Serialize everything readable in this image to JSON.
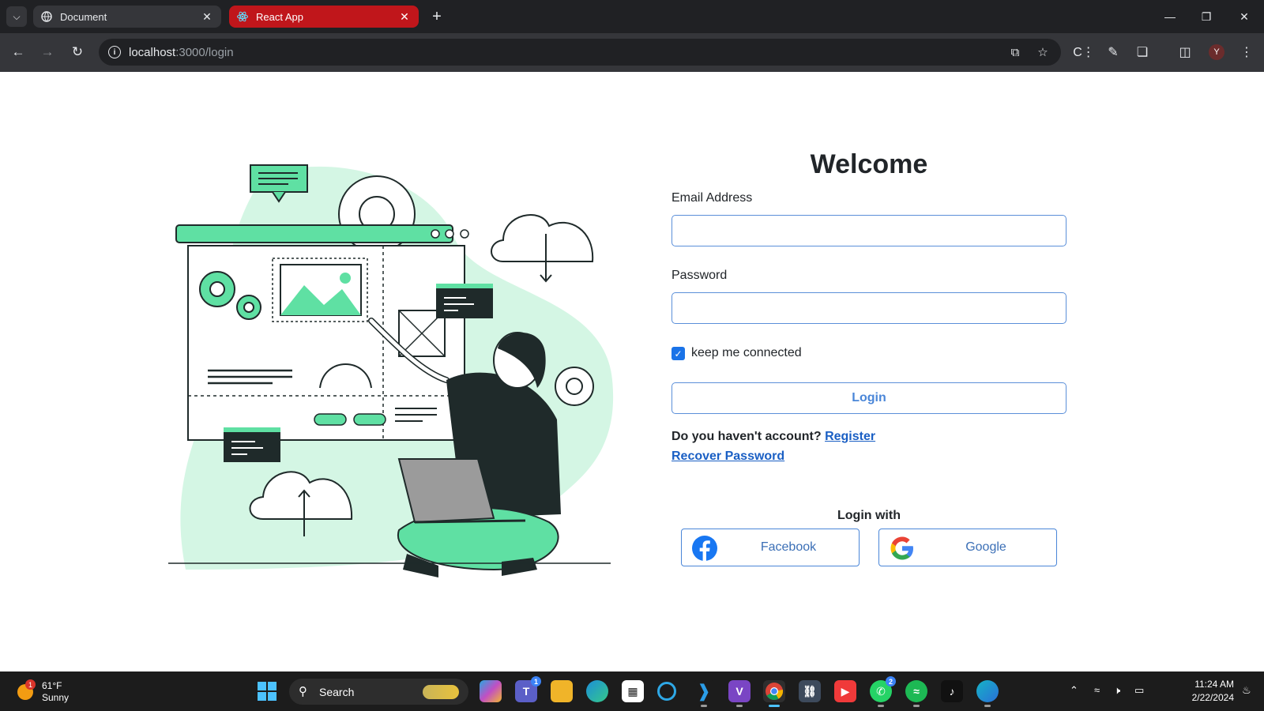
{
  "browser": {
    "tabs": [
      {
        "label": "Document",
        "icon": "globe-icon",
        "active": false
      },
      {
        "label": "React App",
        "icon": "react-icon",
        "active": true
      }
    ],
    "address": {
      "host": "localhost",
      "path": ":3000/login"
    },
    "accent_color": "#c0161b",
    "profile_initial": "Y"
  },
  "login": {
    "title": "Welcome",
    "email_label": "Email Address",
    "email_value": "",
    "password_label": "Password",
    "password_value": "",
    "remember_label": "keep me connected",
    "remember_checked": true,
    "login_button": "Login",
    "no_account_text": "Do you haven't account?",
    "register_link": "Register",
    "recover_link": "Recover Password",
    "login_with": "Login with",
    "facebook_label": "Facebook",
    "google_label": "Google",
    "primary_color": "#1a73e8",
    "illustration_color": "#5fe0a3"
  },
  "taskbar": {
    "weather": {
      "temp": "61°F",
      "condition": "Sunny",
      "badge": "1"
    },
    "search_label": "Search",
    "apps": [
      {
        "name": "copilot",
        "badge": ""
      },
      {
        "name": "teams",
        "badge": "1"
      },
      {
        "name": "file-explorer",
        "badge": ""
      },
      {
        "name": "edge",
        "badge": ""
      },
      {
        "name": "microsoft-store",
        "badge": ""
      },
      {
        "name": "cortana",
        "badge": ""
      },
      {
        "name": "vscode",
        "badge": ""
      },
      {
        "name": "visual-studio",
        "badge": ""
      },
      {
        "name": "chrome",
        "badge": ""
      },
      {
        "name": "sql-server",
        "badge": ""
      },
      {
        "name": "youtube",
        "badge": ""
      },
      {
        "name": "whatsapp",
        "badge": "2"
      },
      {
        "name": "spotify",
        "badge": ""
      },
      {
        "name": "tiktok",
        "badge": ""
      },
      {
        "name": "edge-dev",
        "badge": ""
      }
    ],
    "time": "11:24 AM",
    "date": "2/22/2024"
  }
}
